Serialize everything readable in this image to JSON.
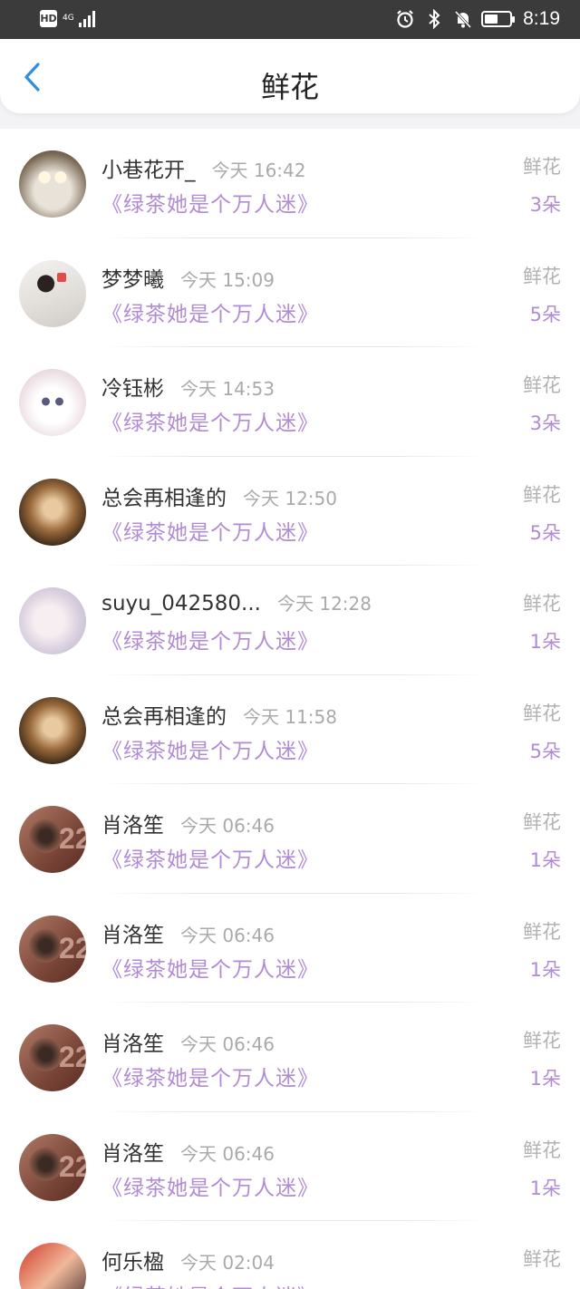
{
  "status_bar": {
    "hd": "HD",
    "network": "4G",
    "time": "8:19",
    "battery_level": 0.55
  },
  "nav": {
    "title": "鲜花",
    "back_icon": "chevron-left-icon"
  },
  "colors": {
    "accent": "#b28bd6",
    "back_icon": "#2e8ee0",
    "muted": "#b2b2b2"
  },
  "records": [
    {
      "name": "小巷花开_",
      "time": "今天 16:42",
      "book": "《绿茶她是个万人迷》",
      "gift": "鲜花",
      "count": "3朵",
      "avatar": "cat1"
    },
    {
      "name": "梦梦曦",
      "time": "今天 15:09",
      "book": "《绿茶她是个万人迷》",
      "gift": "鲜花",
      "count": "5朵",
      "avatar": "girl"
    },
    {
      "name": "冷钰彬",
      "time": "今天 14:53",
      "book": "《绿茶她是个万人迷》",
      "gift": "鲜花",
      "count": "3朵",
      "avatar": "cat2"
    },
    {
      "name": "总会再相逢的",
      "time": "今天 12:50",
      "book": "《绿茶她是个万人迷》",
      "gift": "鲜花",
      "count": "5朵",
      "avatar": "art"
    },
    {
      "name": "suyu_042580...",
      "time": "今天 12:28",
      "book": "《绿茶她是个万人迷》",
      "gift": "鲜花",
      "count": "1朵",
      "avatar": "anime"
    },
    {
      "name": "总会再相逢的",
      "time": "今天 11:58",
      "book": "《绿茶她是个万人迷》",
      "gift": "鲜花",
      "count": "5朵",
      "avatar": "art"
    },
    {
      "name": "肖洛笙",
      "time": "今天 06:46",
      "book": "《绿茶她是个万人迷》",
      "gift": "鲜花",
      "count": "1朵",
      "avatar": "boy"
    },
    {
      "name": "肖洛笙",
      "time": "今天 06:46",
      "book": "《绿茶她是个万人迷》",
      "gift": "鲜花",
      "count": "1朵",
      "avatar": "boy"
    },
    {
      "name": "肖洛笙",
      "time": "今天 06:46",
      "book": "《绿茶她是个万人迷》",
      "gift": "鲜花",
      "count": "1朵",
      "avatar": "boy"
    },
    {
      "name": "肖洛笙",
      "time": "今天 06:46",
      "book": "《绿茶她是个万人迷》",
      "gift": "鲜花",
      "count": "1朵",
      "avatar": "boy"
    },
    {
      "name": "何乐楹",
      "time": "今天 02:04",
      "book": "《绿茶她是个万人迷》",
      "gift": "鲜花",
      "count": "",
      "avatar": "couple"
    }
  ]
}
